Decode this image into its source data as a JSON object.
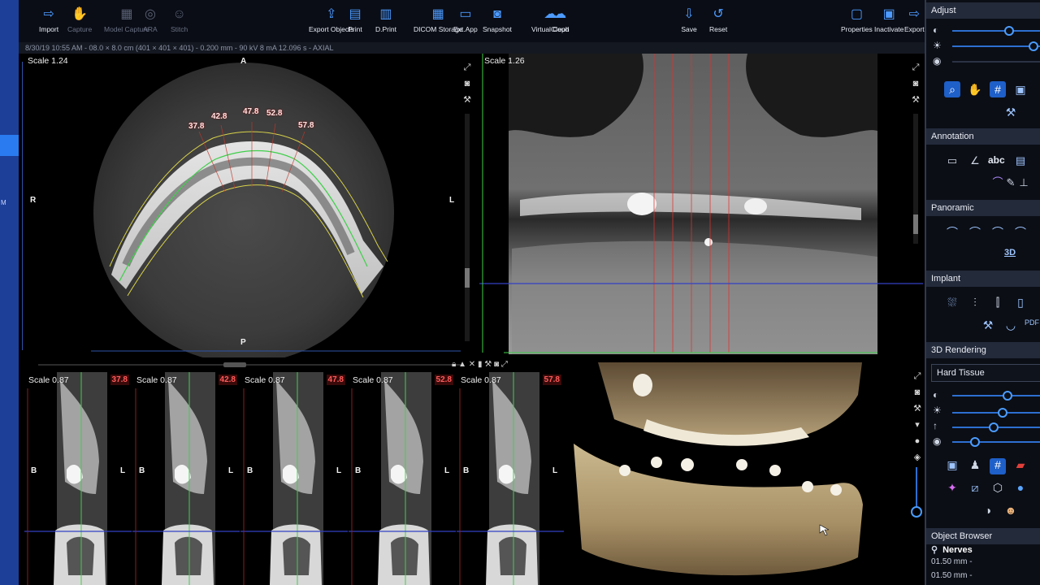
{
  "toolbar": {
    "buttons": [
      {
        "label": "Import",
        "icon": "import-icon",
        "enabled": true
      },
      {
        "label": "Capture",
        "icon": "capture-icon",
        "enabled": false
      },
      {
        "label": "Model Capture",
        "icon": "model-capture-icon",
        "enabled": false
      },
      {
        "label": "ARA",
        "icon": "ara-icon",
        "enabled": false
      },
      {
        "label": "Stitch",
        "icon": "stitch-icon",
        "enabled": false
      },
      {
        "label": "Export Objects",
        "icon": "export-objects-icon",
        "enabled": true
      },
      {
        "label": "Print",
        "icon": "print-icon",
        "enabled": true
      },
      {
        "label": "D.Print",
        "icon": "3d-print-icon",
        "enabled": true
      },
      {
        "label": "DICOM Storage",
        "icon": "dicom-storage-icon",
        "enabled": true
      },
      {
        "label": "Ext.App",
        "icon": "external-app-icon",
        "enabled": true
      },
      {
        "label": "Snapshot",
        "icon": "snapshot-icon",
        "enabled": true
      },
      {
        "label": "Virtual Ceph",
        "icon": "virtual-ceph-icon",
        "enabled": true
      },
      {
        "label": "Cloud",
        "icon": "cloud-icon",
        "enabled": true
      },
      {
        "label": "Save",
        "icon": "save-icon",
        "enabled": true
      },
      {
        "label": "Reset",
        "icon": "reset-icon",
        "enabled": true
      },
      {
        "label": "Properties",
        "icon": "properties-icon",
        "enabled": true
      },
      {
        "label": "Inactivate",
        "icon": "inactivate-icon",
        "enabled": true
      },
      {
        "label": "Export",
        "icon": "export-icon",
        "enabled": true
      }
    ]
  },
  "info_bar": "8/30/19 10:55 AM - 08.0 × 8.0 cm (401 × 401 × 401) - 0.200 mm - 90 kV 8 mA 12.096 s - AXIAL",
  "axial_view": {
    "scale": "Scale 1.24",
    "orient_top": "A",
    "orient_left": "R",
    "orient_right": "L",
    "orient_bottom": "P",
    "slice_labels": [
      "37.8",
      "42.8",
      "47.8",
      "52.8",
      "57.8"
    ]
  },
  "pano_view": {
    "scale": "Scale 1.26"
  },
  "cross_sections": [
    {
      "scale": "Scale 0.87",
      "num": "37.8",
      "b": "B",
      "l": "L"
    },
    {
      "scale": "Scale 0.87",
      "num": "42.8",
      "b": "B",
      "l": "L"
    },
    {
      "scale": "Scale 0.87",
      "num": "47.8",
      "b": "B",
      "l": "L"
    },
    {
      "scale": "Scale 0.87",
      "num": "52.8",
      "b": "B",
      "l": "L"
    },
    {
      "scale": "Scale 0.87",
      "num": "57.8",
      "b": "B",
      "l": "L"
    }
  ],
  "right_panel": {
    "adjust": "Adjust",
    "annotation": "Annotation",
    "abc1": "abc",
    "panoramic": "Panoramic",
    "pano_3d": "3D",
    "implant": "Implant",
    "rendering": "3D Rendering",
    "rendering_mode": "Hard Tissue",
    "object_browser": "Object Browser",
    "nerves": "Nerves",
    "nerve_items": [
      "01.50 mm -",
      "01.50 mm -"
    ],
    "adjust_levels": [
      0.34,
      0.72
    ],
    "rendering_levels": [
      0.57,
      0.5,
      0.41,
      0.2
    ]
  },
  "colors": {
    "accent": "#2a7bf0",
    "panel_bg": "#0b0e15",
    "section_header": "#232a3a",
    "slice_label": "#ff5b5b",
    "nerve_green": "#3fcf4a"
  }
}
